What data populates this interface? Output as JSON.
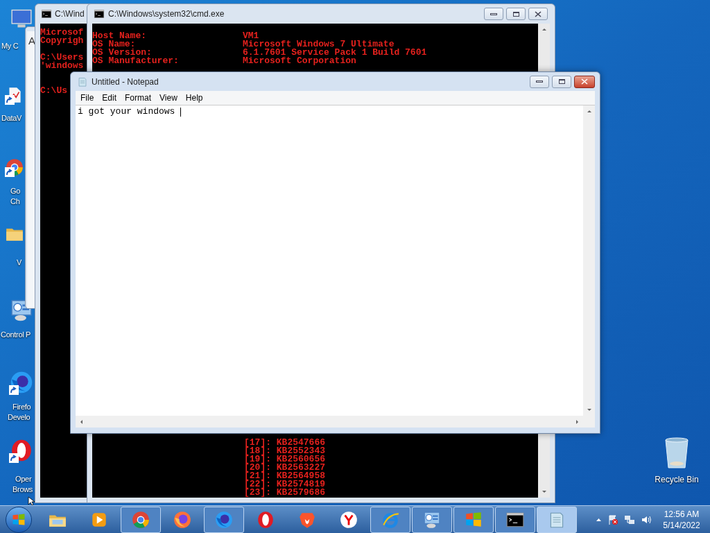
{
  "desktop_icons": [
    {
      "kind": "computer",
      "shortcut": false,
      "lines": [
        "My C"
      ]
    },
    {
      "kind": "document",
      "shortcut": true,
      "lines": [
        "DataV"
      ]
    },
    {
      "kind": "chrome",
      "shortcut": true,
      "lines": [
        "Go",
        "Ch"
      ]
    },
    {
      "kind": "folder",
      "shortcut": false,
      "lines": [
        "V"
      ]
    },
    {
      "kind": "control",
      "shortcut": false,
      "lines": [
        "Control P"
      ]
    },
    {
      "kind": "firefox-dev",
      "shortcut": true,
      "lines": [
        "Firefo",
        "Develo"
      ]
    },
    {
      "kind": "opera",
      "shortcut": true,
      "lines": [
        "Oper",
        "Brows"
      ]
    }
  ],
  "recycle_bin": {
    "label": "Recycle Bin"
  },
  "back_window": {
    "text": "A"
  },
  "console_left": {
    "title": "C:\\Wind",
    "blocks": [
      [
        "Microsof",
        "Copyrigh"
      ],
      [
        "C:\\Users",
        "'windows"
      ],
      [
        "C:\\Us"
      ]
    ]
  },
  "console_front": {
    "title": "C:\\Windows\\system32\\cmd.exe",
    "info": [
      {
        "label": "Host Name:",
        "value": "VM1"
      },
      {
        "label": "OS Name:",
        "value": "Microsoft Windows 7 Ultimate"
      },
      {
        "label": "OS Version:",
        "value": "6.1.7601 Service Pack 1 Build 7601"
      },
      {
        "label": "OS Manufacturer:",
        "value": "Microsoft Corporation"
      }
    ],
    "hotfixes": [
      "[17]: KB2547666",
      "[18]: KB2552343",
      "[19]: KB2560656",
      "[20]: KB2563227",
      "[21]: KB2564958",
      "[22]: KB2574819",
      "[23]: KB2579686"
    ]
  },
  "notepad": {
    "title": "Untitled - Notepad",
    "menu": [
      "File",
      "Edit",
      "Format",
      "View",
      "Help"
    ],
    "text": "i got your windows"
  },
  "taskbar": {
    "buttons": [
      {
        "kind": "explorer",
        "running": false,
        "selected": false
      },
      {
        "kind": "media",
        "running": false,
        "selected": false
      },
      {
        "kind": "chrome",
        "running": true,
        "selected": false
      },
      {
        "kind": "firefox",
        "running": false,
        "selected": false
      },
      {
        "kind": "firefox-dev",
        "running": true,
        "selected": false
      },
      {
        "kind": "opera",
        "running": false,
        "selected": false
      },
      {
        "kind": "brave",
        "running": false,
        "selected": false
      },
      {
        "kind": "yandex",
        "running": false,
        "selected": false
      },
      {
        "kind": "ie",
        "running": true,
        "selected": false
      },
      {
        "kind": "control",
        "running": true,
        "selected": false
      },
      {
        "kind": "windows",
        "running": true,
        "selected": false
      },
      {
        "kind": "cmd",
        "running": true,
        "selected": false
      },
      {
        "kind": "notepad",
        "running": true,
        "selected": true
      }
    ],
    "tray": {
      "time": "12:56 AM",
      "date": "5/14/2022"
    }
  }
}
